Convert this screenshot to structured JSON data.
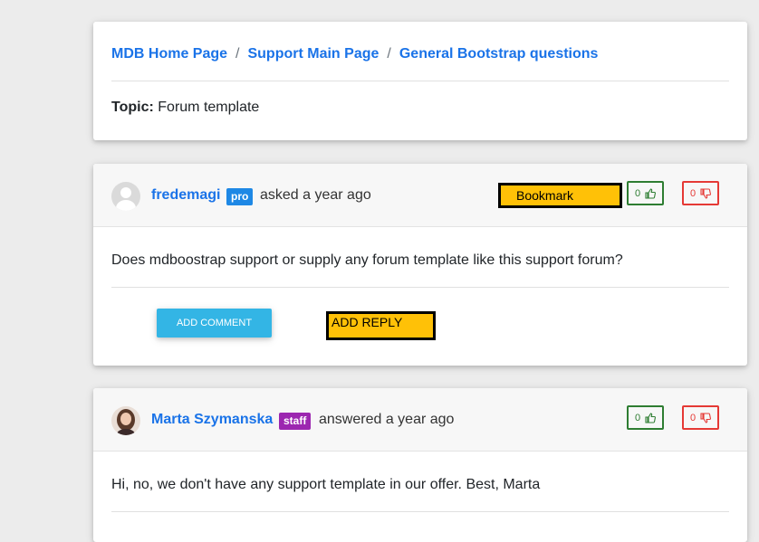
{
  "breadcrumb": {
    "items": [
      "MDB Home Page",
      "Support Main Page",
      "General Bootstrap questions"
    ],
    "separator": "/"
  },
  "topic": {
    "label": "Topic:",
    "value": "Forum template"
  },
  "question": {
    "user": "fredemagi",
    "badge": "pro",
    "action": "asked a year ago",
    "bookmark_label": "Bookmark",
    "upvotes": "0",
    "downvotes": "0",
    "text": "Does mdboostrap support or supply any forum template like this support forum?",
    "add_comment_label": "ADD COMMENT",
    "add_reply_label": "ADD REPLY"
  },
  "answer": {
    "user": "Marta Szymanska",
    "badge": "staff",
    "action": "answered a year ago",
    "upvotes": "0",
    "downvotes": "0",
    "text": "Hi, no, we don't have any support template in our offer. Best, Marta"
  },
  "colors": {
    "link": "#1a73e8",
    "pro_badge": "#1e88e5",
    "staff_badge": "#9c27b0",
    "upvote": "#2e7d32",
    "downvote": "#e53935",
    "highlight": "#ffc107",
    "comment_button": "#33b5e5"
  },
  "icons": {
    "upvote": "thumbs-up-icon",
    "downvote": "thumbs-down-icon",
    "default_avatar": "user-silhouette-icon"
  }
}
